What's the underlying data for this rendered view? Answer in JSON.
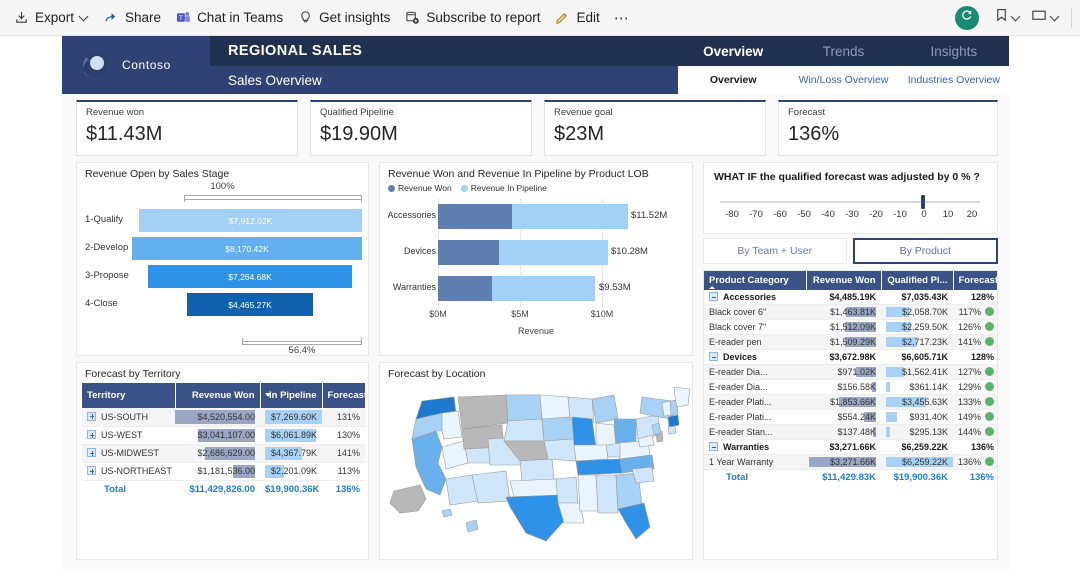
{
  "commandbar": {
    "items": [
      {
        "label": "Export",
        "icon": "export-icon",
        "caret": true
      },
      {
        "label": "Share",
        "icon": "share-icon",
        "caret": false
      },
      {
        "label": "Chat in Teams",
        "icon": "teams-icon",
        "caret": false
      },
      {
        "label": "Get insights",
        "icon": "lightbulb-icon",
        "caret": false
      },
      {
        "label": "Subscribe to report",
        "icon": "subscribe-icon",
        "caret": false
      },
      {
        "label": "Edit",
        "icon": "pencil-icon",
        "caret": false
      },
      {
        "label": "⋯",
        "icon": "more-icon",
        "caret": false
      }
    ],
    "refresh_icon": "refresh-icon",
    "bookmark_icon": "bookmark-icon",
    "view_icon": "view-icon"
  },
  "report_header": {
    "brand": "Contoso",
    "brand_logo": "contoso-logo",
    "title": "REGIONAL SALES",
    "subtitle": "Sales Overview",
    "nav_top": [
      {
        "label": "Overview",
        "active": true
      },
      {
        "label": "Trends",
        "active": false
      },
      {
        "label": "Insights",
        "active": false
      }
    ],
    "nav_sub": [
      {
        "label": "Overview",
        "active": true
      },
      {
        "label": "Win/Loss Overview",
        "active": false
      },
      {
        "label": "Industries Overview",
        "active": false
      }
    ]
  },
  "kpis": [
    {
      "label": "Revenue won",
      "value": "$11.43M"
    },
    {
      "label": "Qualified Pipeline",
      "value": "$19.90M"
    },
    {
      "label": "Revenue goal",
      "value": "$23M"
    },
    {
      "label": "Forecast",
      "value": "136%"
    }
  ],
  "funnel": {
    "title": "Revenue Open by Sales Stage",
    "top_label": "100%",
    "bottom_label": "56.4%",
    "chart_data": {
      "type": "bar",
      "title": "Revenue Open by Sales Stage",
      "categories": [
        "1-Qualify",
        "2-Develop",
        "3-Propose",
        "4-Close"
      ],
      "values": [
        7912.02,
        8170.42,
        7264.68,
        4465.27
      ],
      "labels": [
        "$7,912.02K",
        "$8,170.42K",
        "$7,264.68K",
        "$4,465.27K"
      ],
      "colors": [
        "#a3d0f5",
        "#62b0ef",
        "#2e92e8",
        "#0f62ae"
      ],
      "widths_pct": [
        96.8,
        100.0,
        88.9,
        54.6
      ],
      "xlabel": "",
      "ylabel": "",
      "grid": false,
      "legend": "none"
    }
  },
  "stacked": {
    "title": "Revenue Won and Revenue In Pipeline by Product LOB",
    "chart_data": {
      "type": "bar",
      "title": "Revenue Won and Revenue In Pipeline by Product LOB",
      "categories": [
        "Accessories",
        "Devices",
        "Warranties"
      ],
      "series": [
        {
          "name": "Revenue Won",
          "color": "#5e7fb0",
          "values": [
            4.49,
            3.67,
            3.27
          ]
        },
        {
          "name": "Revenue In Pipeline",
          "color": "#a3d0f5",
          "values": [
            7.03,
            6.61,
            6.26
          ]
        }
      ],
      "totals": [
        11.52,
        10.28,
        9.53
      ],
      "total_labels": [
        "$11.52M",
        "$10.28M",
        "$9.53M"
      ],
      "xlabel": "Revenue",
      "ylabel": "",
      "xticks": [
        "$0M",
        "$5M",
        "$10M"
      ],
      "xlim": [
        0,
        12.5
      ],
      "grid": true,
      "legend": "top-left",
      "stacked": true
    }
  },
  "whatif": {
    "question": "WHAT IF the qualified forecast was adjusted by  0 % ?",
    "value": 0,
    "ticks": [
      "-80",
      "-70",
      "-60",
      "-50",
      "-40",
      "-30",
      "-20",
      "-10",
      "0",
      "10",
      "20"
    ],
    "min": -85,
    "max": 25,
    "segments": [
      {
        "label": "By Team + User",
        "active": false
      },
      {
        "label": "By Product",
        "active": true
      }
    ]
  },
  "product_table": {
    "columns": [
      "Product Category",
      "Revenue Won",
      "Qualified Pi...",
      "Forecast %"
    ],
    "sort_column": "Product Category",
    "sort_direction": "asc",
    "rows": [
      {
        "name": "Accessories",
        "level": 0,
        "won": "$4,485.19K",
        "pipeline": "$7,035.43K",
        "forecast": "128%",
        "won_pct": 0,
        "pipe_pct": 0,
        "dot": false
      },
      {
        "name": "Black cover 6\"",
        "level": 1,
        "won": "$1,463.81K",
        "pipeline": "$2,058.70K",
        "forecast": "117%",
        "won_pct": 40,
        "pipe_pct": 32,
        "dot": true
      },
      {
        "name": "Black cover 7\"",
        "level": 1,
        "won": "$1,512.09K",
        "pipeline": "$2,259.50K",
        "forecast": "126%",
        "won_pct": 41,
        "pipe_pct": 35,
        "dot": true
      },
      {
        "name": "E-reader pen",
        "level": 1,
        "won": "$1,509.29K",
        "pipeline": "$2,717.23K",
        "forecast": "141%",
        "won_pct": 41,
        "pipe_pct": 43,
        "dot": true
      },
      {
        "name": "Devices",
        "level": 0,
        "won": "$3,672.98K",
        "pipeline": "$6,605.71K",
        "forecast": "128%",
        "won_pct": 0,
        "pipe_pct": 0,
        "dot": false
      },
      {
        "name": "E-reader Dia...",
        "level": 1,
        "won": "$971.02K",
        "pipeline": "$1,562.41K",
        "forecast": "127%",
        "won_pct": 27,
        "pipe_pct": 25,
        "dot": true
      },
      {
        "name": "E-reader Dia...",
        "level": 1,
        "won": "$156.58K",
        "pipeline": "$361.14K",
        "forecast": "129%",
        "won_pct": 5,
        "pipe_pct": 6,
        "dot": true
      },
      {
        "name": "E-reader Plati...",
        "level": 1,
        "won": "$1,853.66K",
        "pipeline": "$3,455.63K",
        "forecast": "133%",
        "won_pct": 50,
        "pipe_pct": 55,
        "dot": true
      },
      {
        "name": "E-reader Plati...",
        "level": 1,
        "won": "$554.24K",
        "pipeline": "$931.40K",
        "forecast": "149%",
        "won_pct": 16,
        "pipe_pct": 15,
        "dot": true
      },
      {
        "name": "E-reader Stan...",
        "level": 1,
        "won": "$137.48K",
        "pipeline": "$295.13K",
        "forecast": "144%",
        "won_pct": 4,
        "pipe_pct": 5,
        "dot": true
      },
      {
        "name": "Warranties",
        "level": 0,
        "won": "$3,271.66K",
        "pipeline": "$6,259.22K",
        "forecast": "136%",
        "won_pct": 0,
        "pipe_pct": 0,
        "dot": false
      },
      {
        "name": "1 Year Warranty",
        "level": 1,
        "won": "$3,271.66K",
        "pipeline": "$6,259.22K",
        "forecast": "136%",
        "won_pct": 89,
        "pipe_pct": 99,
        "dot": true
      }
    ],
    "total": {
      "name": "Total",
      "won": "$11,429.83K",
      "pipeline": "$19,900.36K",
      "forecast": "136%"
    }
  },
  "territory_table": {
    "title": "Forecast by Territory",
    "columns": [
      "Territory",
      "Revenue Won",
      "In Pipeline",
      "Forecast %"
    ],
    "sort_column": "In Pipeline",
    "sort_direction": "desc",
    "rows": [
      {
        "name": "US-SOUTH",
        "won": "$4,520,554.00",
        "pipeline": "$7,269.60K",
        "forecast": "131%",
        "won_pct": 100,
        "pipe_pct": 100
      },
      {
        "name": "US-WEST",
        "won": "$3,041,107.00",
        "pipeline": "$6,061.89K",
        "forecast": "130%",
        "won_pct": 67,
        "pipe_pct": 83
      },
      {
        "name": "US-MIDWEST",
        "won": "$2,686,629.00",
        "pipeline": "$4,367.79K",
        "forecast": "141%",
        "won_pct": 59,
        "pipe_pct": 60
      },
      {
        "name": "US-NORTHEAST",
        "won": "$1,181,536.00",
        "pipeline": "$2,201.09K",
        "forecast": "113%",
        "won_pct": 26,
        "pipe_pct": 30
      }
    ],
    "total": {
      "name": "Total",
      "won": "$11,429,826.00",
      "pipeline": "$19,900.36K",
      "forecast": "136%"
    }
  },
  "map": {
    "title": "Forecast by Location",
    "chart_data": {
      "type": "heatmap",
      "title": "Forecast by Location",
      "region": "United States",
      "color_scale": [
        "#eaf4fd",
        "#cfe6fa",
        "#a8d2f5",
        "#67b0ec",
        "#2e92e8",
        "#1e7ad0"
      ],
      "no_data_color": "#b8b8b8"
    }
  }
}
